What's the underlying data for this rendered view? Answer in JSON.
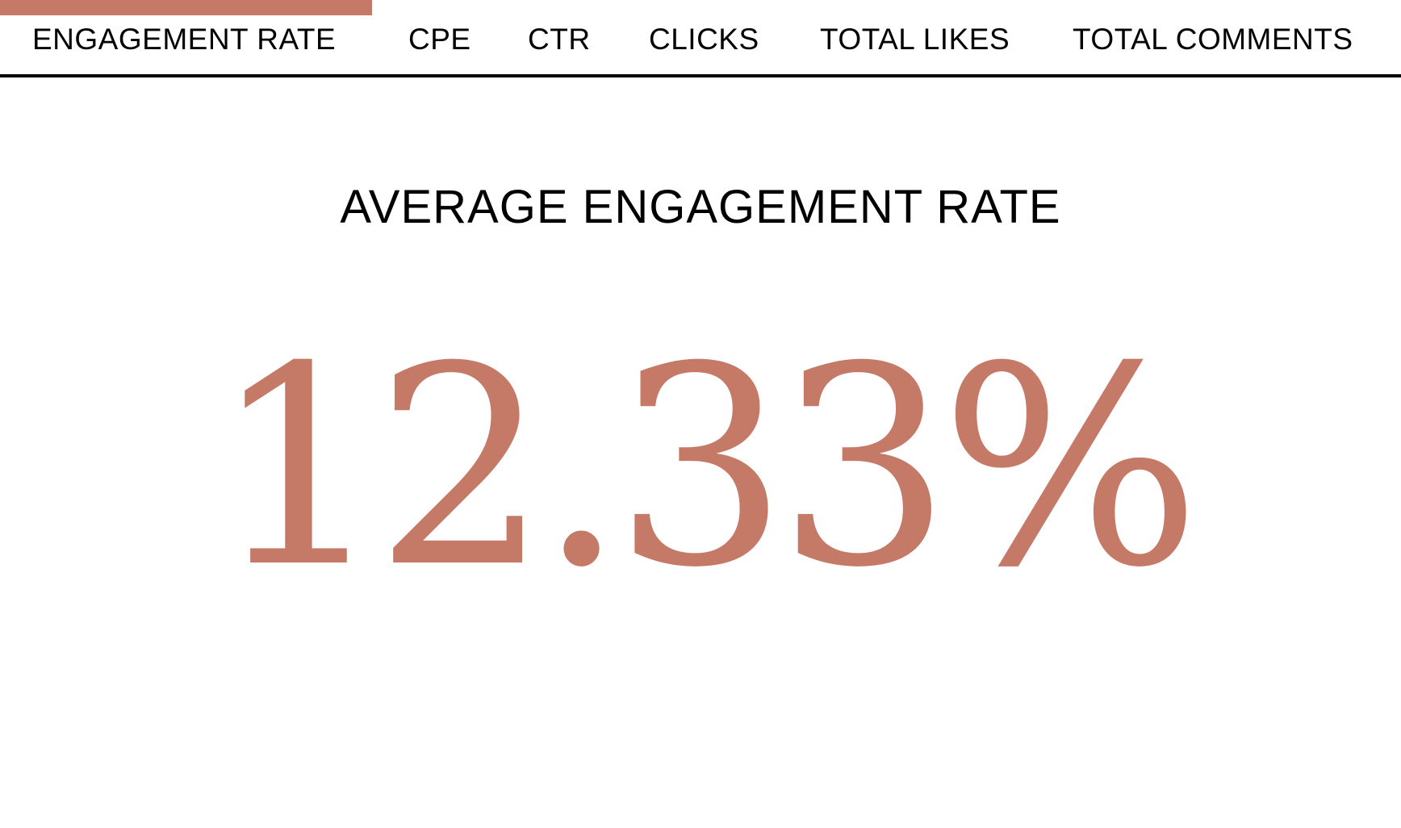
{
  "colors": {
    "accent": "#c57a68",
    "text": "#000000",
    "background": "#ffffff"
  },
  "tabs": [
    {
      "label": "ENGAGEMENT RATE",
      "active": true
    },
    {
      "label": "CPE",
      "active": false
    },
    {
      "label": "CTR",
      "active": false
    },
    {
      "label": "CLICKS",
      "active": false
    },
    {
      "label": "TOTAL LIKES",
      "active": false
    },
    {
      "label": "TOTAL COMMENTS",
      "active": false
    }
  ],
  "metric": {
    "title": "AVERAGE ENGAGEMENT RATE",
    "value": "12.33%"
  }
}
